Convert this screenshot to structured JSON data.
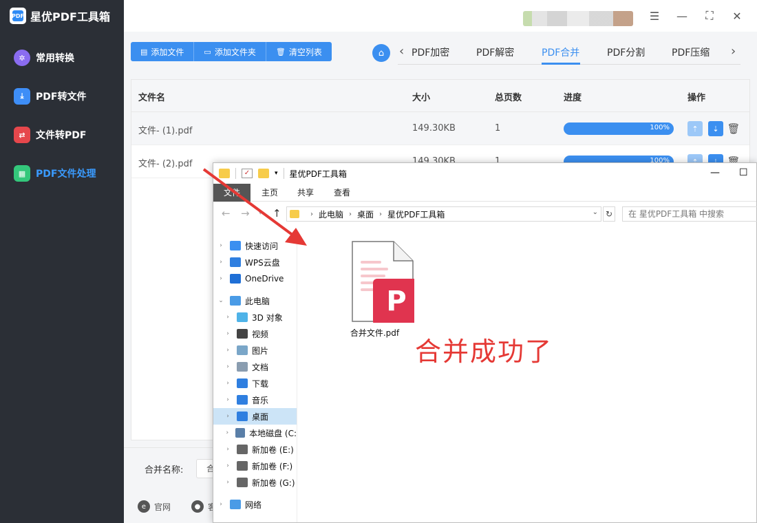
{
  "app": {
    "title": "星优PDF工具箱"
  },
  "sidebar": {
    "items": [
      {
        "label": "常用转换",
        "icon": "grid-icon"
      },
      {
        "label": "PDF转文件",
        "icon": "pdf-to-file-icon"
      },
      {
        "label": "文件转PDF",
        "icon": "file-to-pdf-icon"
      },
      {
        "label": "PDF文件处理",
        "icon": "pdf-process-icon",
        "active": true
      }
    ]
  },
  "toolbar": {
    "add_file": "添加文件",
    "add_folder": "添加文件夹",
    "clear_list": "清空列表"
  },
  "tabs": {
    "items": [
      "PDF加密",
      "PDF解密",
      "PDF合并",
      "PDF分割",
      "PDF压缩"
    ],
    "active": "PDF合并"
  },
  "table": {
    "headers": [
      "文件名",
      "大小",
      "总页数",
      "进度",
      "操作"
    ],
    "rows": [
      {
        "name": "文件- (1).pdf",
        "size": "149.30KB",
        "pages": "1",
        "progress": "100%",
        "progress_value": 100
      },
      {
        "name": "文件- (2).pdf",
        "size": "149.30KB",
        "pages": "1",
        "progress": "100%",
        "progress_value": 100
      }
    ]
  },
  "bottom": {
    "merge_label": "合并名称:",
    "merge_value": "合",
    "links": [
      {
        "label": "官网",
        "icon": "ie-icon"
      },
      {
        "label": "客",
        "icon": "chat-icon"
      }
    ]
  },
  "explorer": {
    "title": "星优PDF工具箱",
    "ribbon_tabs": [
      "文件",
      "主页",
      "共享",
      "查看"
    ],
    "breadcrumb": [
      "此电脑",
      "桌面",
      "星优PDF工具箱"
    ],
    "search_placeholder": "在 星优PDF工具箱 中搜索",
    "nav": [
      {
        "label": "快速访问",
        "icon": "star-icon",
        "level": 0,
        "color": "#3b8ff0"
      },
      {
        "label": "WPS云盘",
        "icon": "cloud-icon",
        "level": 0,
        "color": "#2f7fe0"
      },
      {
        "label": "OneDrive",
        "icon": "onedrive-icon",
        "level": 0,
        "color": "#1f6fd6"
      },
      {
        "label": "此电脑",
        "icon": "computer-icon",
        "level": 0,
        "expanded": true,
        "color": "#4a9be6"
      },
      {
        "label": "3D 对象",
        "icon": "cube-icon",
        "level": 1,
        "color": "#4fb3e8"
      },
      {
        "label": "视频",
        "icon": "video-icon",
        "level": 1,
        "color": "#444444"
      },
      {
        "label": "图片",
        "icon": "picture-icon",
        "level": 1,
        "color": "#7aa6c8"
      },
      {
        "label": "文档",
        "icon": "document-icon",
        "level": 1,
        "color": "#8a9db0"
      },
      {
        "label": "下载",
        "icon": "download-icon",
        "level": 1,
        "color": "#2f7fe0"
      },
      {
        "label": "音乐",
        "icon": "music-icon",
        "level": 1,
        "color": "#2f7fe0"
      },
      {
        "label": "桌面",
        "icon": "desktop-icon",
        "level": 1,
        "selected": true,
        "color": "#2f7fe0"
      },
      {
        "label": "本地磁盘 (C:",
        "icon": "disk-icon",
        "level": 1,
        "color": "#5a7fa8"
      },
      {
        "label": "新加卷 (E:)",
        "icon": "drive-icon",
        "level": 1,
        "color": "#666666"
      },
      {
        "label": "新加卷 (F:)",
        "icon": "drive-icon",
        "level": 1,
        "color": "#666666"
      },
      {
        "label": "新加卷 (G:)",
        "icon": "drive-icon",
        "level": 1,
        "color": "#666666"
      },
      {
        "label": "网络",
        "icon": "network-icon",
        "level": 0,
        "color": "#4a9be6"
      }
    ],
    "file": {
      "name": "合并文件.pdf",
      "icon": "pdf-file-icon"
    }
  },
  "annotation": {
    "text": "合并成功了",
    "color": "#e53935"
  },
  "colors": {
    "accent": "#3b8ff0",
    "sidebar": "#2b2f36",
    "pdf_red": "#e0344f"
  }
}
